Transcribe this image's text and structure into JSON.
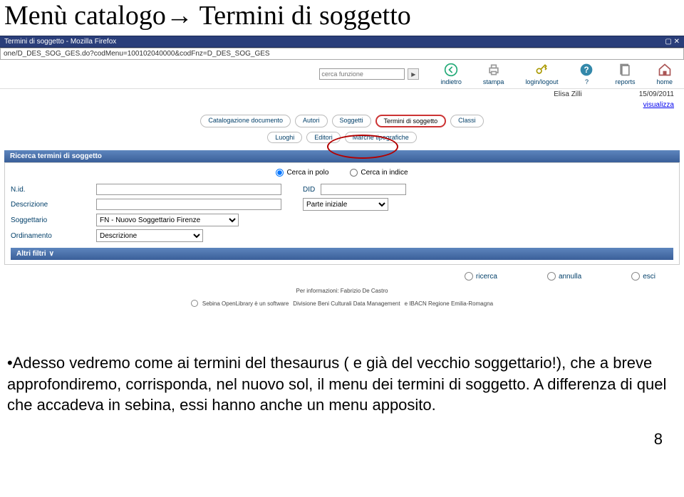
{
  "slide": {
    "title": "Menù catalogo→ Termini di soggetto"
  },
  "browser": {
    "tabtitle": "Termini di soggetto - Mozilla Firefox",
    "addr": "one/D_DES_SOG_GES.do?codMenu=100102040000&codFnz=D_DES_SOG_GES"
  },
  "appbar": {
    "func_label": "cerca funzione",
    "tools": {
      "back": "indietro",
      "print": "stampa",
      "login": "login/logout",
      "help": "?",
      "reports": "reports",
      "home": "home"
    }
  },
  "user": {
    "name": "Elisa Zilli",
    "date": "15/09/2011"
  },
  "visual_link": "visualizza",
  "crumbs": {
    "r1": [
      "Catalogazione documento",
      "Autori",
      "Soggetti",
      "Termini di soggetto",
      "Classi"
    ],
    "r2": [
      "Luoghi",
      "Editori",
      "Marche tipografiche"
    ]
  },
  "panel": {
    "title": "Ricerca termini di soggetto"
  },
  "scope": {
    "polo": "Cerca in polo",
    "indice": "Cerca in indice"
  },
  "form": {
    "nid": "N.id.",
    "did": "DID",
    "descr": "Descrizione",
    "descr_mode": "Parte iniziale",
    "sogg": "Soggettario",
    "sogg_val": "FN - Nuovo Soggettario Firenze",
    "ord": "Ordinamento",
    "ord_val": "Descrizione"
  },
  "altri": "Altri filtri",
  "actions": {
    "ricerca": "ricerca",
    "annulla": "annulla",
    "esci": "esci"
  },
  "credits": {
    "l1": "Per informazioni: Fabrizio De Castro",
    "l2a": "Sebina OpenLibrary è un software",
    "l2b": "Divisione Beni Culturali Data Management",
    "l2c": "e  IBACN Regione Emilia-Romagna"
  },
  "caption": "Adesso vedremo come ai termini del thesaurus ( e già del vecchio soggettario!), che a breve approfondiremo,  corrisponda, nel nuovo sol, il menu dei termini di soggetto. A differenza di quel che accadeva in sebina, essi hanno anche un menu apposito.",
  "pagenum": "8"
}
